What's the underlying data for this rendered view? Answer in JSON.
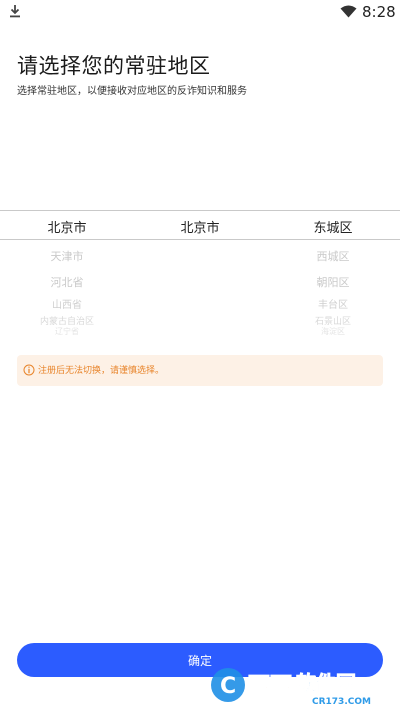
{
  "status_bar": {
    "time": "8:28",
    "icons": [
      "download-icon",
      "wifi-icon"
    ]
  },
  "header": {
    "title": "请选择您的常驻地区",
    "subtitle": "选择常驻地区，以便接收对应地区的反诈知识和服务"
  },
  "picker": {
    "columns": [
      {
        "name": "province",
        "selected": "北京市",
        "items": [
          "天津市",
          "河北省",
          "山西省",
          "内蒙古自治区",
          "辽宁省"
        ]
      },
      {
        "name": "city",
        "selected": "北京市",
        "items": []
      },
      {
        "name": "district",
        "selected": "东城区",
        "items": [
          "西城区",
          "朝阳区",
          "丰台区",
          "石景山区",
          "海淀区"
        ]
      }
    ]
  },
  "notice": {
    "icon": "info-icon",
    "text": "注册后无法切换，请谨慎选择。"
  },
  "confirm_button": {
    "label": "确定"
  },
  "watermark": {
    "brand": "西西软件园",
    "site": "CR173.COM"
  },
  "colors": {
    "primary": "#2c5cff",
    "notice_bg": "#fdf1e6",
    "notice_text": "#e8842a"
  }
}
